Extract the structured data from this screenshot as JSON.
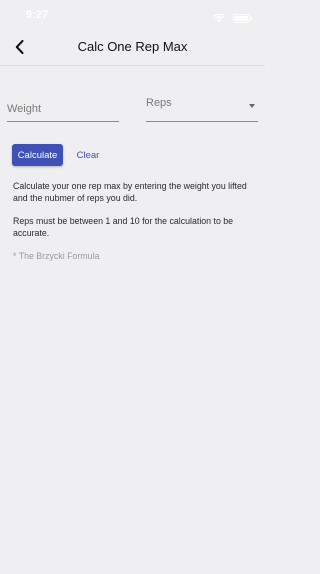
{
  "status_bar": {
    "time": "9:27"
  },
  "header": {
    "title": "Calc One Rep Max"
  },
  "form": {
    "weight_placeholder": "Weight",
    "reps_label": "Reps",
    "calculate_label": "Calculate",
    "clear_label": "Clear"
  },
  "content": {
    "paragraph_1": "Calculate your one rep max by entering the weight you lifted and the nubmer of reps you did.",
    "paragraph_2": "Reps must be between 1 and 10 for the calculation to be accurate.",
    "note": "* The Brzycki Formula"
  },
  "colors": {
    "accent": "#3f51b5",
    "background": "#efeff1"
  },
  "icons": [
    "back-arrow-icon",
    "wifi-icon",
    "battery-icon",
    "dropdown-arrow-icon"
  ]
}
